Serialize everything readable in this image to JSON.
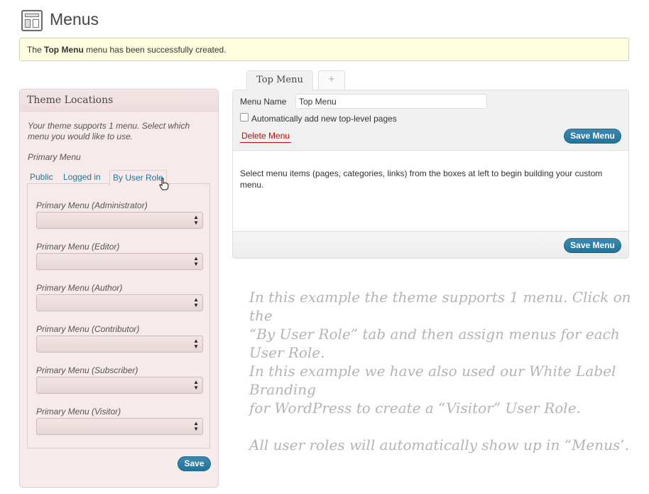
{
  "page": {
    "icon": "menus-layout-icon",
    "title": "Menus"
  },
  "notice": {
    "prefix": "The ",
    "menu_name": "Top Menu",
    "suffix": " menu has been successfully created."
  },
  "locations": {
    "title": "Theme Locations",
    "description": "Your theme supports 1 menu. Select which menu you would like to use.",
    "primary_label": "Primary Menu",
    "tabs": [
      "Public",
      "Logged in",
      "By User Role"
    ],
    "active_tab": "By User Role",
    "roles": [
      {
        "label": "Primary Menu (Administrator)",
        "value": ""
      },
      {
        "label": "Primary Menu (Editor)",
        "value": ""
      },
      {
        "label": "Primary Menu (Author)",
        "value": ""
      },
      {
        "label": "Primary Menu (Contributor)",
        "value": ""
      },
      {
        "label": "Primary Menu (Subscriber)",
        "value": ""
      },
      {
        "label": "Primary Menu (Visitor)",
        "value": ""
      }
    ],
    "save_label": "Save"
  },
  "editor": {
    "tabs": {
      "active": "Top Menu",
      "add": "+"
    },
    "menu_name_label": "Menu Name",
    "menu_name_value": "Top Menu",
    "auto_add_label": "Automatically add new top-level pages",
    "auto_add_checked": false,
    "delete_label": "Delete Menu",
    "save_label": "Save Menu",
    "instructions": "Select menu items (pages, categories, links) from the boxes at left to begin building your custom menu."
  },
  "annotation": {
    "line1": "In this example the theme supports 1 menu. Click on the",
    "line2": "“By User Role” tab and then assign menus for each",
    "line3": "User Role.",
    "line4": "In this example we have also used our White Label Branding",
    "line5": "for WordPress to create a “Visitor” User Role.",
    "line6": "All user roles will automatically show up in “Menus’."
  },
  "colors": {
    "accent": "#21759b",
    "notice_bg": "#ffffe0",
    "notice_border": "#e6db55",
    "locations_bg": "#f6eaea",
    "delete": "#bc0b0b"
  }
}
